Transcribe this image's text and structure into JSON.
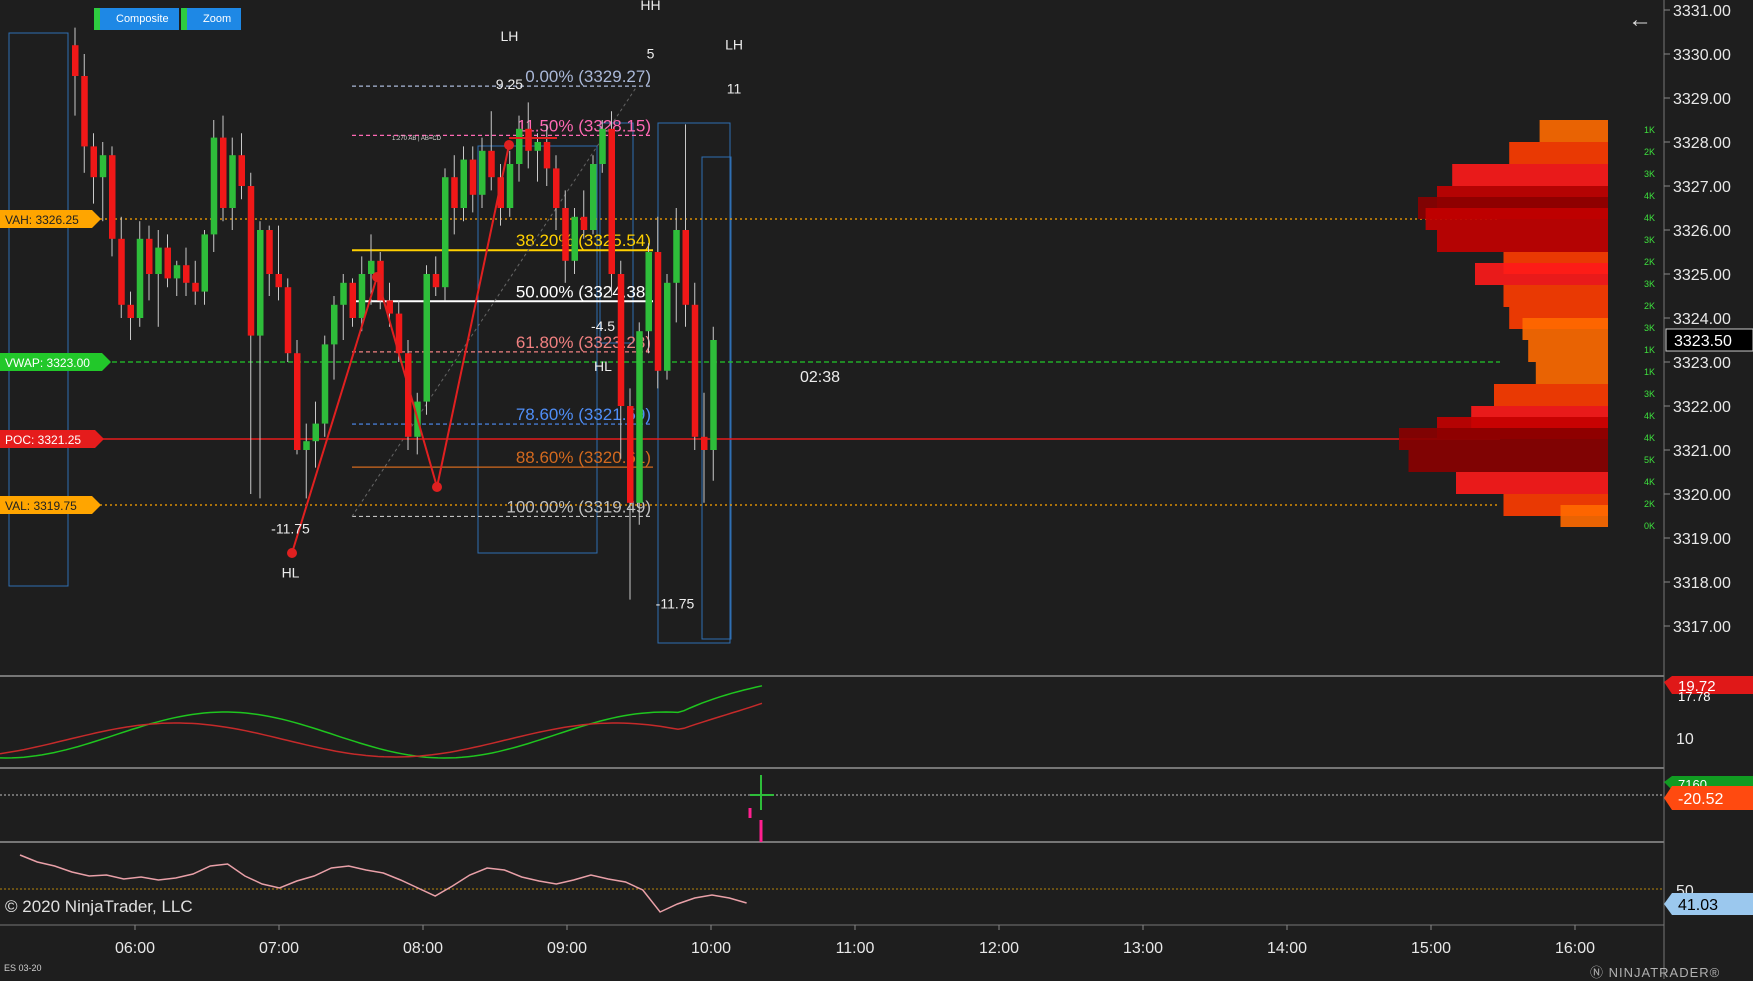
{
  "toolbar": {
    "composite_label": "Composite",
    "zoom_label": "Zoom"
  },
  "back_icon": "←",
  "copyright": "© 2020 NinjaTrader, LLC",
  "instrument": "ES 03-20",
  "logo": "Ⓝ NINJATRADER®",
  "timer": "02:38",
  "colors": {
    "bg": "#1e1e1e",
    "up": "#2ebd3a",
    "down": "#f01818",
    "vah": "#ffa500",
    "vwap": "#22c82a",
    "poc": "#e51c1c"
  },
  "chart_data": {
    "type": "candlestick",
    "price_axis": {
      "labels": [
        "3331.00",
        "3330.00",
        "3329.00",
        "3328.00",
        "3327.00",
        "3326.00",
        "3325.00",
        "3324.00",
        "3323.00",
        "3322.00",
        "3321.00",
        "3320.00",
        "3319.00",
        "3318.00",
        "3317.00"
      ],
      "ylim": [
        3316.75,
        3331.75
      ]
    },
    "time_axis": {
      "labels": [
        "06:00",
        "07:00",
        "08:00",
        "09:00",
        "10:00",
        "11:00",
        "12:00",
        "13:00",
        "14:00",
        "15:00",
        "16:00"
      ]
    },
    "last_price": "3323.50",
    "levels": [
      {
        "label": "VAH: 3326.25",
        "price": 3326.25,
        "color": "#ffa500"
      },
      {
        "label": "VWAP: 3323.00",
        "price": 3323.0,
        "color": "#22c82a"
      },
      {
        "label": "POC: 3321.25",
        "price": 3321.25,
        "color": "#e51c1c"
      },
      {
        "label": "VAL: 3319.75",
        "price": 3319.75,
        "color": "#ffa500"
      }
    ],
    "fibs": [
      {
        "label": "0.00% (3329.27)",
        "price": 3329.27,
        "color": "#aab8d8"
      },
      {
        "label": "11.50% (3328.15)",
        "price": 3328.15,
        "color": "#ff69b4"
      },
      {
        "label": "38.20% (3325.54)",
        "price": 3325.54,
        "color": "#ffd000"
      },
      {
        "label": "50.00% (3324.38)",
        "price": 3324.38,
        "color": "#ffffff"
      },
      {
        "label": "61.80% (3323.23)",
        "price": 3323.23,
        "color": "#f08080"
      },
      {
        "label": "78.60% (3321.59)",
        "price": 3321.59,
        "color": "#4f8ef7"
      },
      {
        "label": "88.60% (3320.61)",
        "price": 3320.61,
        "color": "#d2691e"
      },
      {
        "label": "100.00% (3319.49)",
        "price": 3319.49,
        "color": "#c0c0c0"
      }
    ],
    "annotations": [
      {
        "text": "LH",
        "t": 8.6,
        "p": 3330.3
      },
      {
        "text": "HH",
        "t": 9.58,
        "p": 3331.0
      },
      {
        "text": "5",
        "t": 9.58,
        "p": 3329.9
      },
      {
        "text": "LH",
        "t": 10.16,
        "p": 3330.1
      },
      {
        "text": "11",
        "t": 10.16,
        "p": 3329.1
      },
      {
        "text": "9.25",
        "t": 8.6,
        "p": 3329.2
      },
      {
        "text": "-4.5",
        "t": 9.25,
        "p": 3323.7
      },
      {
        "text": "HL",
        "t": 9.25,
        "p": 3322.8
      },
      {
        "text": "-11.75",
        "t": 7.08,
        "p": 3319.1
      },
      {
        "text": "HL",
        "t": 7.08,
        "p": 3318.1
      },
      {
        "text": "-11.75",
        "t": 9.75,
        "p": 3317.4
      }
    ],
    "abcd_label": "1.270 AB | AB=CD",
    "candles": [
      [
        3330.2,
        3330.6,
        3328.6,
        3329.5
      ],
      [
        3329.5,
        3330.0,
        3327.3,
        3327.9
      ],
      [
        3327.9,
        3328.2,
        3326.6,
        3327.2
      ],
      [
        3327.2,
        3328.0,
        3326.2,
        3327.7
      ],
      [
        3327.7,
        3327.9,
        3325.4,
        3325.8
      ],
      [
        3325.8,
        3326.3,
        3324.0,
        3324.3
      ],
      [
        3324.3,
        3324.6,
        3323.5,
        3324.0
      ],
      [
        3324.0,
        3326.2,
        3323.8,
        3325.8
      ],
      [
        3325.8,
        3326.1,
        3324.4,
        3325.0
      ],
      [
        3325.0,
        3326.0,
        3323.8,
        3325.6
      ],
      [
        3325.6,
        3325.9,
        3324.7,
        3324.9
      ],
      [
        3324.9,
        3325.3,
        3324.5,
        3325.2
      ],
      [
        3325.2,
        3325.6,
        3324.5,
        3324.8
      ],
      [
        3324.8,
        3325.3,
        3324.3,
        3324.6
      ],
      [
        3324.6,
        3326.0,
        3324.3,
        3325.9
      ],
      [
        3325.9,
        3328.5,
        3325.5,
        3328.1
      ],
      [
        3328.1,
        3328.6,
        3326.2,
        3326.5
      ],
      [
        3326.5,
        3328.1,
        3326.0,
        3327.7
      ],
      [
        3327.7,
        3328.2,
        3326.7,
        3327.0
      ],
      [
        3327.0,
        3327.3,
        3320.0,
        3323.6
      ],
      [
        3323.6,
        3326.2,
        3319.9,
        3326.0
      ],
      [
        3326.0,
        3326.1,
        3324.5,
        3325.0
      ],
      [
        3325.0,
        3326.1,
        3324.4,
        3324.7
      ],
      [
        3324.7,
        3324.9,
        3323.0,
        3323.2
      ],
      [
        3323.2,
        3323.5,
        3320.9,
        3321.0
      ],
      [
        3321.0,
        3321.6,
        3319.9,
        3321.2
      ],
      [
        3321.2,
        3322.1,
        3320.6,
        3321.6
      ],
      [
        3321.6,
        3323.6,
        3321.3,
        3323.4
      ],
      [
        3323.4,
        3324.5,
        3322.6,
        3324.3
      ],
      [
        3324.3,
        3325.0,
        3323.5,
        3324.8
      ],
      [
        3324.8,
        3324.9,
        3323.8,
        3324.0
      ],
      [
        3324.0,
        3325.4,
        3323.7,
        3325.0
      ],
      [
        3325.0,
        3325.9,
        3324.3,
        3325.3
      ],
      [
        3325.3,
        3325.5,
        3324.2,
        3324.4
      ],
      [
        3324.4,
        3324.8,
        3323.8,
        3324.1
      ],
      [
        3324.1,
        3324.4,
        3323.0,
        3323.2
      ],
      [
        3323.2,
        3323.5,
        3321.0,
        3321.3
      ],
      [
        3321.3,
        3322.3,
        3320.9,
        3322.1
      ],
      [
        3322.1,
        3325.2,
        3321.8,
        3325.0
      ],
      [
        3325.0,
        3325.4,
        3324.5,
        3324.7
      ],
      [
        3324.7,
        3327.4,
        3324.4,
        3327.2
      ],
      [
        3327.2,
        3327.7,
        3325.9,
        3326.5
      ],
      [
        3326.5,
        3327.9,
        3326.2,
        3327.6
      ],
      [
        3327.6,
        3327.9,
        3326.4,
        3326.8
      ],
      [
        3326.8,
        3328.1,
        3326.5,
        3327.8
      ],
      [
        3327.8,
        3328.7,
        3326.9,
        3327.2
      ],
      [
        3327.2,
        3327.5,
        3326.1,
        3326.5
      ],
      [
        3326.5,
        3327.8,
        3326.3,
        3327.5
      ],
      [
        3327.5,
        3328.6,
        3327.1,
        3328.3
      ],
      [
        3328.3,
        3328.9,
        3327.4,
        3327.8
      ],
      [
        3327.8,
        3328.2,
        3327.1,
        3328.0
      ],
      [
        3328.0,
        3328.4,
        3327.0,
        3327.4
      ],
      [
        3327.4,
        3327.7,
        3326.0,
        3326.5
      ],
      [
        3326.5,
        3326.9,
        3324.8,
        3325.3
      ],
      [
        3325.3,
        3326.5,
        3325.0,
        3326.3
      ],
      [
        3326.3,
        3326.9,
        3325.8,
        3326.0
      ],
      [
        3326.0,
        3327.7,
        3325.9,
        3327.5
      ],
      [
        3327.5,
        3328.5,
        3327.3,
        3328.3
      ],
      [
        3328.3,
        3328.7,
        3324.5,
        3325.0
      ],
      [
        3325.0,
        3325.3,
        3320.8,
        3322.0
      ],
      [
        3322.0,
        3322.4,
        3317.6,
        3319.8
      ],
      [
        3319.8,
        3323.9,
        3319.3,
        3323.7
      ],
      [
        3323.7,
        3325.7,
        3323.2,
        3325.5
      ],
      [
        3325.5,
        3326.3,
        3322.4,
        3322.8
      ],
      [
        3322.8,
        3325.0,
        3322.6,
        3324.8
      ],
      [
        3324.8,
        3326.5,
        3323.9,
        3326.0
      ],
      [
        3326.0,
        3328.4,
        3323.8,
        3324.3
      ],
      [
        3324.3,
        3324.8,
        3321.0,
        3321.3
      ],
      [
        3321.3,
        3322.3,
        3319.8,
        3321.0
      ],
      [
        3321.0,
        3323.8,
        3320.3,
        3323.5
      ]
    ],
    "volume_profile": {
      "labels": [
        "1K",
        "2K",
        "3K",
        "4K",
        "4K",
        "3K",
        "2K",
        "3K",
        "2K",
        "3K",
        "1K",
        "1K",
        "3K",
        "4K",
        "4K",
        "5K",
        "4K",
        "2K",
        "0K"
      ],
      "bins": [
        {
          "price": 3328.25,
          "vol": 0.36
        },
        {
          "price": 3327.75,
          "vol": 0.52
        },
        {
          "price": 3327.25,
          "vol": 0.82
        },
        {
          "price": 3326.75,
          "vol": 0.9
        },
        {
          "price": 3326.5,
          "vol": 1.0
        },
        {
          "price": 3326.25,
          "vol": 0.96
        },
        {
          "price": 3325.75,
          "vol": 0.9
        },
        {
          "price": 3325.25,
          "vol": 0.55
        },
        {
          "price": 3325.0,
          "vol": 0.7
        },
        {
          "price": 3324.5,
          "vol": 0.55
        },
        {
          "price": 3324.0,
          "vol": 0.52
        },
        {
          "price": 3323.75,
          "vol": 0.45
        },
        {
          "price": 3323.25,
          "vol": 0.42
        },
        {
          "price": 3322.75,
          "vol": 0.38
        },
        {
          "price": 3322.25,
          "vol": 0.6
        },
        {
          "price": 3321.75,
          "vol": 0.72
        },
        {
          "price": 3321.5,
          "vol": 0.9
        },
        {
          "price": 3321.25,
          "vol": 1.1
        },
        {
          "price": 3320.75,
          "vol": 1.05
        },
        {
          "price": 3320.25,
          "vol": 0.8
        },
        {
          "price": 3319.75,
          "vol": 0.55
        },
        {
          "price": 3319.5,
          "vol": 0.25
        }
      ]
    },
    "osc1": {
      "axis_labels": [
        "10"
      ],
      "value_labels": [
        "19.72",
        "17.78"
      ]
    },
    "osc2": {
      "value_labels": [
        "7160",
        "-20.52"
      ]
    },
    "osc3": {
      "axis_labels": [
        "50"
      ],
      "value_labels": [
        "41.03"
      ]
    }
  }
}
